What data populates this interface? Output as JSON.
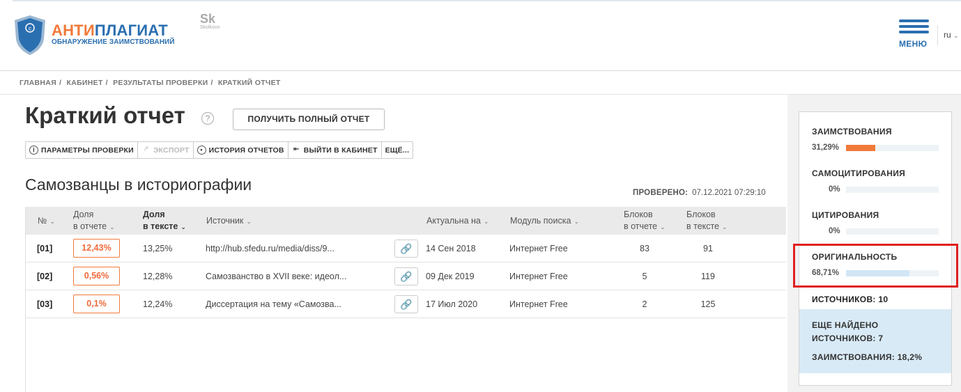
{
  "header": {
    "logo_part1": "АНТИ",
    "logo_part2": "ПЛАГИАТ",
    "logo_subtitle": "ОБНАРУЖЕНИЕ ЗАИМСТВОВАНИЙ",
    "partner_logo": "Sk",
    "partner_logo_small": "Skolkovo",
    "menu_label": "МЕНЮ",
    "language": "ru",
    "colors": {
      "brand_orange": "#f07a3a",
      "brand_blue": "#2a6fb0"
    }
  },
  "breadcrumbs": [
    "ГЛАВНАЯ",
    "КАБИНЕТ",
    "РЕЗУЛЬТАТЫ ПРОВЕРКИ",
    "КРАТКИЙ ОТЧЕТ"
  ],
  "page": {
    "title": "Краткий отчет",
    "help_icon": "?",
    "full_report_button": "ПОЛУЧИТЬ ПОЛНЫЙ ОТЧЕТ"
  },
  "toolbar": {
    "items": [
      {
        "label": "ПАРАМЕТРЫ ПРОВЕРКИ",
        "icon": "info-icon",
        "disabled": false
      },
      {
        "label": "ЭКСПОРТ",
        "icon": "export-icon",
        "disabled": true
      },
      {
        "label": "ИСТОРИЯ ОТЧЕТОВ",
        "icon": "history-icon",
        "disabled": false
      },
      {
        "label": "ВЫЙТИ В КАБИНЕТ",
        "icon": "exit-icon",
        "disabled": false
      },
      {
        "label": "ЕЩЁ...",
        "icon": "",
        "disabled": false
      }
    ]
  },
  "document": {
    "name": "Самозванцы в историографии",
    "checked_label": "ПРОВЕРЕНО:",
    "checked_value": "07.12.2021 07:29:10"
  },
  "table": {
    "headers": {
      "num": "№",
      "share_report_1": "Доля",
      "share_report_2": "в отчете",
      "share_text_1": "Доля",
      "share_text_2": "в тексте",
      "source": "Источник",
      "actual": "Актуальна на",
      "module": "Модуль поиска",
      "blocks_report_1": "Блоков",
      "blocks_report_2": "в отчете",
      "blocks_text_1": "Блоков",
      "blocks_text_2": "в тексте"
    },
    "rows": [
      {
        "num": "[01]",
        "share_report": "12,43%",
        "share_text": "13,25%",
        "source": "http://hub.sfedu.ru/media/diss/9...",
        "actual": "14 Сен 2018",
        "module": "Интернет Free",
        "blocks_report": "83",
        "blocks_text": "91"
      },
      {
        "num": "[02]",
        "share_report": "0,56%",
        "share_text": "12,28%",
        "source": "Самозванство в XVII веке: идеол...",
        "actual": "09 Дек 2019",
        "module": "Интернет Free",
        "blocks_report": "5",
        "blocks_text": "119"
      },
      {
        "num": "[03]",
        "share_report": "0,1%",
        "share_text": "12,24%",
        "source": "Диссертация на тему «Самозва...",
        "actual": "17 Июл 2020",
        "module": "Интернет Free",
        "blocks_report": "2",
        "blocks_text": "125"
      }
    ]
  },
  "stats": {
    "borrowing_label": "ЗАИМСТВОВАНИЯ",
    "borrowing_value": "31,29%",
    "borrowing_fraction": 0.3129,
    "selfcite_label": "САМОЦИТИРОВАНИЯ",
    "selfcite_value": "0%",
    "selfcite_fraction": 0,
    "citation_label": "ЦИТИРОВАНИЯ",
    "citation_value": "0%",
    "citation_fraction": 0,
    "originality_label": "ОРИГИНАЛЬНОСТЬ",
    "originality_value": "68,71%",
    "originality_fraction": 0.6871,
    "sources_label": "ИСТОЧНИКОВ:",
    "sources_value": "10",
    "more_found_line1": "ЕЩЕ НАЙДЕНО",
    "more_found_line2_label": "ИСТОЧНИКОВ:",
    "more_found_line2_value": "7",
    "more_borrow_label": "ЗАИМСТВОВАНИЯ:",
    "more_borrow_value": "18,2%",
    "colors": {
      "borrowing": "#f07a3a",
      "originality": "#d2e6f5",
      "highlight": "#e02020"
    }
  }
}
